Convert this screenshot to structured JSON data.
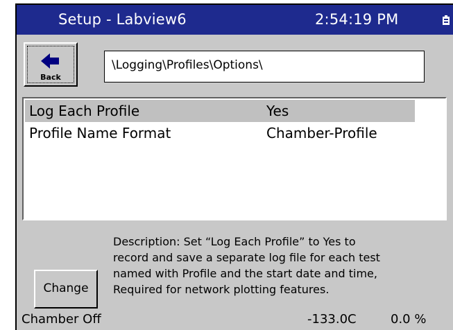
{
  "window": {
    "title": "Setup - Labview6",
    "clock": "2:54:19 PM"
  },
  "toolbar": {
    "back_label": "Back",
    "path": "\\Logging\\Profiles\\Options\\"
  },
  "options": [
    {
      "name": "Log Each Profile",
      "value": "Yes",
      "selected": true
    },
    {
      "name": "Profile Name Format",
      "value": "Chamber-Profile",
      "selected": false
    }
  ],
  "description": {
    "lines": [
      "Description:  Set “Log Each Profile” to Yes to",
      "record and save a separate log file for each test",
      "named with Profile and the start date and time,",
      "Required for network plotting features."
    ]
  },
  "actions": {
    "change_label": "Change"
  },
  "status": {
    "state": "Chamber Off",
    "temperature": "-133.0C",
    "humidity": "0.0 %"
  },
  "colors": {
    "titlebar": "#1e2a8e",
    "panel": "#c8c8c8",
    "selection": "#c0c0c0"
  },
  "icons": {
    "back": "left-arrow-icon",
    "tray": "battery-icon"
  }
}
